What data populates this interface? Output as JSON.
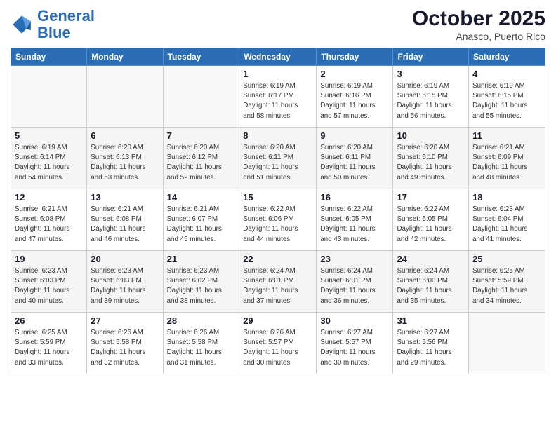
{
  "header": {
    "logo_line1": "General",
    "logo_line2": "Blue",
    "month": "October 2025",
    "location": "Anasco, Puerto Rico"
  },
  "weekdays": [
    "Sunday",
    "Monday",
    "Tuesday",
    "Wednesday",
    "Thursday",
    "Friday",
    "Saturday"
  ],
  "weeks": [
    [
      {
        "day": "",
        "info": ""
      },
      {
        "day": "",
        "info": ""
      },
      {
        "day": "",
        "info": ""
      },
      {
        "day": "1",
        "info": "Sunrise: 6:19 AM\nSunset: 6:17 PM\nDaylight: 11 hours\nand 58 minutes."
      },
      {
        "day": "2",
        "info": "Sunrise: 6:19 AM\nSunset: 6:16 PM\nDaylight: 11 hours\nand 57 minutes."
      },
      {
        "day": "3",
        "info": "Sunrise: 6:19 AM\nSunset: 6:15 PM\nDaylight: 11 hours\nand 56 minutes."
      },
      {
        "day": "4",
        "info": "Sunrise: 6:19 AM\nSunset: 6:15 PM\nDaylight: 11 hours\nand 55 minutes."
      }
    ],
    [
      {
        "day": "5",
        "info": "Sunrise: 6:19 AM\nSunset: 6:14 PM\nDaylight: 11 hours\nand 54 minutes."
      },
      {
        "day": "6",
        "info": "Sunrise: 6:20 AM\nSunset: 6:13 PM\nDaylight: 11 hours\nand 53 minutes."
      },
      {
        "day": "7",
        "info": "Sunrise: 6:20 AM\nSunset: 6:12 PM\nDaylight: 11 hours\nand 52 minutes."
      },
      {
        "day": "8",
        "info": "Sunrise: 6:20 AM\nSunset: 6:11 PM\nDaylight: 11 hours\nand 51 minutes."
      },
      {
        "day": "9",
        "info": "Sunrise: 6:20 AM\nSunset: 6:11 PM\nDaylight: 11 hours\nand 50 minutes."
      },
      {
        "day": "10",
        "info": "Sunrise: 6:20 AM\nSunset: 6:10 PM\nDaylight: 11 hours\nand 49 minutes."
      },
      {
        "day": "11",
        "info": "Sunrise: 6:21 AM\nSunset: 6:09 PM\nDaylight: 11 hours\nand 48 minutes."
      }
    ],
    [
      {
        "day": "12",
        "info": "Sunrise: 6:21 AM\nSunset: 6:08 PM\nDaylight: 11 hours\nand 47 minutes."
      },
      {
        "day": "13",
        "info": "Sunrise: 6:21 AM\nSunset: 6:08 PM\nDaylight: 11 hours\nand 46 minutes."
      },
      {
        "day": "14",
        "info": "Sunrise: 6:21 AM\nSunset: 6:07 PM\nDaylight: 11 hours\nand 45 minutes."
      },
      {
        "day": "15",
        "info": "Sunrise: 6:22 AM\nSunset: 6:06 PM\nDaylight: 11 hours\nand 44 minutes."
      },
      {
        "day": "16",
        "info": "Sunrise: 6:22 AM\nSunset: 6:05 PM\nDaylight: 11 hours\nand 43 minutes."
      },
      {
        "day": "17",
        "info": "Sunrise: 6:22 AM\nSunset: 6:05 PM\nDaylight: 11 hours\nand 42 minutes."
      },
      {
        "day": "18",
        "info": "Sunrise: 6:23 AM\nSunset: 6:04 PM\nDaylight: 11 hours\nand 41 minutes."
      }
    ],
    [
      {
        "day": "19",
        "info": "Sunrise: 6:23 AM\nSunset: 6:03 PM\nDaylight: 11 hours\nand 40 minutes."
      },
      {
        "day": "20",
        "info": "Sunrise: 6:23 AM\nSunset: 6:03 PM\nDaylight: 11 hours\nand 39 minutes."
      },
      {
        "day": "21",
        "info": "Sunrise: 6:23 AM\nSunset: 6:02 PM\nDaylight: 11 hours\nand 38 minutes."
      },
      {
        "day": "22",
        "info": "Sunrise: 6:24 AM\nSunset: 6:01 PM\nDaylight: 11 hours\nand 37 minutes."
      },
      {
        "day": "23",
        "info": "Sunrise: 6:24 AM\nSunset: 6:01 PM\nDaylight: 11 hours\nand 36 minutes."
      },
      {
        "day": "24",
        "info": "Sunrise: 6:24 AM\nSunset: 6:00 PM\nDaylight: 11 hours\nand 35 minutes."
      },
      {
        "day": "25",
        "info": "Sunrise: 6:25 AM\nSunset: 5:59 PM\nDaylight: 11 hours\nand 34 minutes."
      }
    ],
    [
      {
        "day": "26",
        "info": "Sunrise: 6:25 AM\nSunset: 5:59 PM\nDaylight: 11 hours\nand 33 minutes."
      },
      {
        "day": "27",
        "info": "Sunrise: 6:26 AM\nSunset: 5:58 PM\nDaylight: 11 hours\nand 32 minutes."
      },
      {
        "day": "28",
        "info": "Sunrise: 6:26 AM\nSunset: 5:58 PM\nDaylight: 11 hours\nand 31 minutes."
      },
      {
        "day": "29",
        "info": "Sunrise: 6:26 AM\nSunset: 5:57 PM\nDaylight: 11 hours\nand 30 minutes."
      },
      {
        "day": "30",
        "info": "Sunrise: 6:27 AM\nSunset: 5:57 PM\nDaylight: 11 hours\nand 30 minutes."
      },
      {
        "day": "31",
        "info": "Sunrise: 6:27 AM\nSunset: 5:56 PM\nDaylight: 11 hours\nand 29 minutes."
      },
      {
        "day": "",
        "info": ""
      }
    ]
  ]
}
